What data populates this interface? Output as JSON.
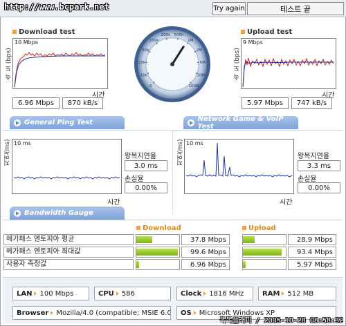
{
  "header": {
    "site": "http://www.bcpark.net",
    "try_again": "Try again",
    "end_test": "테스트 끝"
  },
  "download": {
    "title": "Download test",
    "y_label": "속 도 (bps)",
    "scale": "10 Mbps",
    "x_label": "시간",
    "mbps": "6.96 Mbps",
    "kbs": "870 kB/s"
  },
  "upload": {
    "title": "Upload test",
    "y_label": "속 도 (bps)",
    "scale": "9 Mbps",
    "x_label": "시간",
    "mbps": "5.97 Mbps",
    "kbs": "747 kB/s"
  },
  "gauge": {
    "ticks": [
      "0",
      "10k",
      "20k",
      "50k",
      "100k",
      "200k",
      "500k",
      "1M",
      "2M",
      "5M",
      "10M",
      "100M"
    ],
    "level": 0.62
  },
  "tabs": {
    "ping": "General Ping Test",
    "game": "Network Game & VoIP Test",
    "bandwidth": "Bandwidth Gauge"
  },
  "ping": {
    "y_label": "지연(ms)",
    "scale": "10 ms",
    "x_label": "시간",
    "rtt_label": "왕복지연율",
    "rtt": "3.0 ms",
    "loss_label": "손실율",
    "loss": "0.00%"
  },
  "game": {
    "y_label": "지연(ms)",
    "scale": "10 ms",
    "x_label": "시간",
    "rtt_label": "왕복지연율",
    "rtt": "3.3 ms",
    "loss_label": "손실율",
    "loss": "0.00%"
  },
  "bandwidth": {
    "download_header": "Download",
    "upload_header": "Upload",
    "rows": [
      {
        "label": "메가패스 엔토피아 평균",
        "down": "37.8 Mbps",
        "down_level": 0.38,
        "up": "28.9 Mbps",
        "up_level": 0.29
      },
      {
        "label": "메가패스 엔토피아 최대값",
        "down": "99.6 Mbps",
        "down_level": 1.0,
        "up": "93.4 Mbps",
        "up_level": 0.94
      },
      {
        "label": "사용자 측정값",
        "down": "6.96 Mbps",
        "down_level": 0.07,
        "up": "5.97 Mbps",
        "up_level": 0.06
      }
    ]
  },
  "system": {
    "lan_label": "LAN",
    "lan": "100 Mbps",
    "cpu_label": "CPU",
    "cpu": "586",
    "clock_label": "Clock",
    "clock": "1816 MHz",
    "ram_label": "RAM",
    "ram": "512 MB",
    "browser_label": "Browser",
    "browser": "Mozilla/4.0 (compatible; MSIE 6.0",
    "os_label": "OS",
    "os": "Microsoft Windows XP"
  },
  "watermark": "똑똑플래피 / 2005-10-28 08:58:32",
  "colors": {
    "tab": "#7fa2d8",
    "accent": "#f3a03a",
    "bar": "#9acd32",
    "series_red": "#cc2020",
    "series_blue": "#1a2fa0"
  }
}
